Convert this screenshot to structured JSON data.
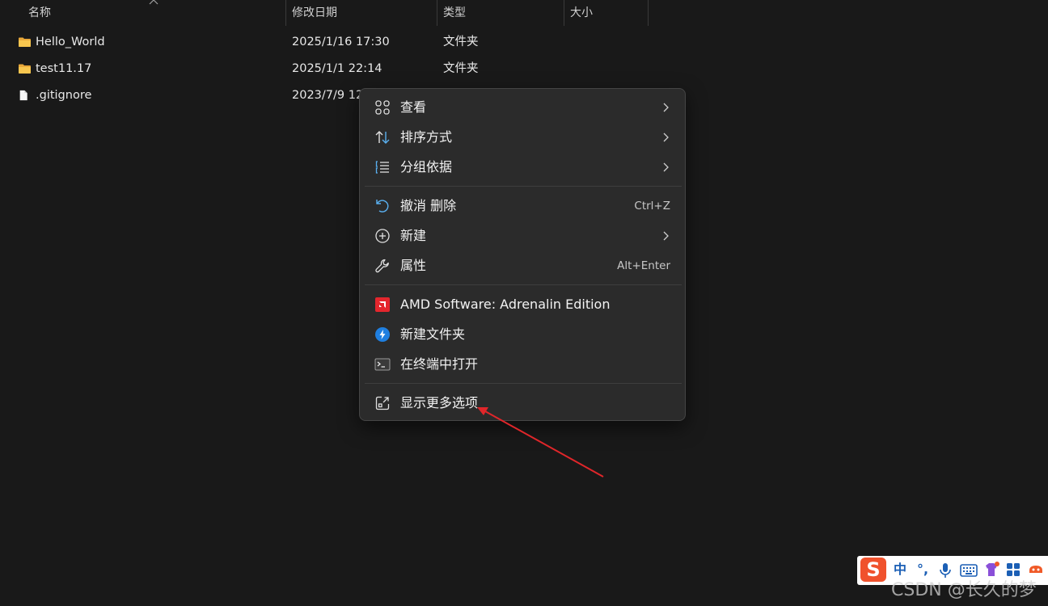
{
  "columns": {
    "name": "名称",
    "modified": "修改日期",
    "type": "类型",
    "size": "大小"
  },
  "files": [
    {
      "icon": "folder-icon",
      "name": "Hello_World",
      "modified": "2025/1/16 17:30",
      "type": "文件夹"
    },
    {
      "icon": "folder-icon",
      "name": "test11.17",
      "modified": "2025/1/1 22:14",
      "type": "文件夹"
    },
    {
      "icon": "file-icon",
      "name": ".gitignore",
      "modified": "2023/7/9 12",
      "type": ""
    }
  ],
  "context_menu": {
    "items": [
      {
        "icon": "view-grid-icon",
        "label": "查看",
        "shortcut": "",
        "submenu": true
      },
      {
        "icon": "sort-icon",
        "label": "排序方式",
        "shortcut": "",
        "submenu": true
      },
      {
        "icon": "group-list-icon",
        "label": "分组依据",
        "shortcut": "",
        "submenu": true
      },
      {
        "icon": "undo-icon",
        "label": "撤消 删除",
        "shortcut": "Ctrl+Z",
        "submenu": false
      },
      {
        "icon": "new-plus-icon",
        "label": "新建",
        "shortcut": "",
        "submenu": true
      },
      {
        "icon": "wrench-icon",
        "label": "属性",
        "shortcut": "Alt+Enter",
        "submenu": false
      },
      {
        "icon": "amd-icon",
        "label": "AMD Software: Adrenalin Edition",
        "shortcut": "",
        "submenu": false
      },
      {
        "icon": "new-folder-app-icon",
        "label": "新建文件夹",
        "shortcut": "",
        "submenu": false
      },
      {
        "icon": "terminal-icon",
        "label": "在终端中打开",
        "shortcut": "",
        "submenu": false
      },
      {
        "icon": "more-options-icon",
        "label": "显示更多选项",
        "shortcut": "",
        "submenu": false
      }
    ]
  },
  "ime_toolbar": {
    "logo": "S",
    "mode": "中",
    "punct": "°,",
    "icons": [
      "microphone-icon",
      "keyboard-icon",
      "skin-icon",
      "apps-grid-icon",
      "tools-icon"
    ]
  },
  "watermark": "CSDN @长久的梦",
  "colors": {
    "background": "#191919",
    "menu_bg": "#2b2b2b",
    "folder": "#f4c04b",
    "amd_red": "#e4262d",
    "annotation_arrow": "#e0262a",
    "ime_blue": "#1b5fb5"
  }
}
